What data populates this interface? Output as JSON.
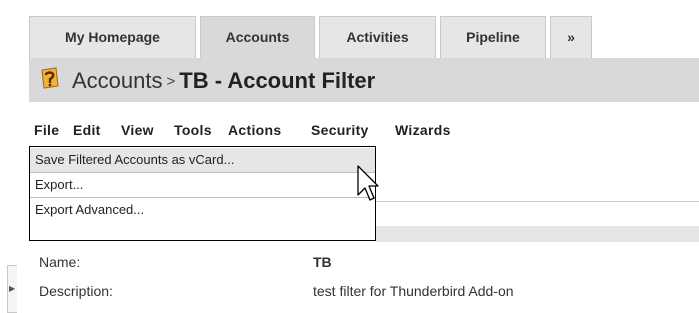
{
  "tabs": [
    {
      "label": "My Homepage",
      "active": false
    },
    {
      "label": "Accounts",
      "active": true
    },
    {
      "label": "Activities",
      "active": false
    },
    {
      "label": "Pipeline",
      "active": false
    },
    {
      "label": "»",
      "active": false
    }
  ],
  "header": {
    "icon": "module-logo-icon",
    "module": "Accounts",
    "separator": ">",
    "title": "TB - Account Filter"
  },
  "menubar": {
    "items": [
      "File",
      "Edit",
      "View",
      "Tools",
      "Actions",
      "Security",
      "Wizards"
    ]
  },
  "file_menu": {
    "items": [
      {
        "label": "Save Filtered Accounts as vCard...",
        "highlighted": true
      },
      {
        "label": "Export...",
        "highlighted": false
      },
      {
        "label": "Export Advanced...",
        "highlighted": false
      }
    ]
  },
  "fields": [
    {
      "label": "Name:",
      "value": "TB"
    },
    {
      "label": "Description:",
      "value": "test filter for Thunderbird Add-on"
    }
  ],
  "colors": {
    "tab_bg": "#e6e6e6",
    "title_band": "#d9d9d9",
    "highlight": "#e6e6e6"
  }
}
